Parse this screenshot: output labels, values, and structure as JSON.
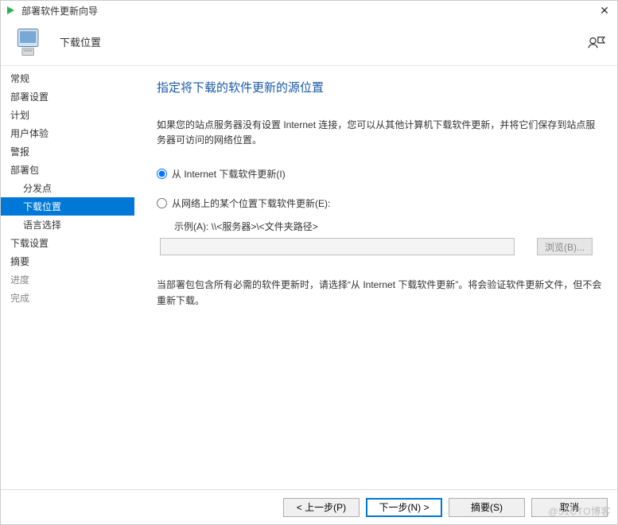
{
  "titlebar": {
    "title": "部署软件更新向导",
    "close_glyph": "✕"
  },
  "header": {
    "title": "下载位置"
  },
  "sidebar": {
    "items": [
      {
        "label": "常规",
        "key": "general"
      },
      {
        "label": "部署设置",
        "key": "deploy-settings"
      },
      {
        "label": "计划",
        "key": "schedule"
      },
      {
        "label": "用户体验",
        "key": "ux"
      },
      {
        "label": "警报",
        "key": "alerts"
      },
      {
        "label": "部署包",
        "key": "package"
      },
      {
        "label": "分发点",
        "key": "distpoints",
        "sub": true
      },
      {
        "label": "下载位置",
        "key": "download-loc",
        "sub": true,
        "selected": true
      },
      {
        "label": "语言选择",
        "key": "languages",
        "sub": true
      },
      {
        "label": "下载设置",
        "key": "download-settings"
      },
      {
        "label": "摘要",
        "key": "summary"
      },
      {
        "label": "进度",
        "key": "progress",
        "disabled": true
      },
      {
        "label": "完成",
        "key": "complete",
        "disabled": true
      }
    ]
  },
  "content": {
    "title": "指定将下载的软件更新的源位置",
    "description": "如果您的站点服务器没有设置 Internet 连接，您可以从其他计算机下载软件更新，并将它们保存到站点服务器可访问的网络位置。",
    "radio_internet": "从 Internet 下载软件更新(I)",
    "radio_network": "从网络上的某个位置下载软件更新(E):",
    "example_label": "示例(A): \\\\<服务器>\\<文件夹路径>",
    "path_value": "",
    "browse_label": "浏览(B)...",
    "note": "当部署包包含所有必需的软件更新时，请选择“从 Internet 下载软件更新”。将会验证软件更新文件，但不会重新下载。",
    "selected_radio": "internet"
  },
  "footer": {
    "back": "<  上一步(P)",
    "next": "下一步(N)  >",
    "summary": "摘要(S)",
    "cancel": "取消"
  },
  "watermark": "@51CTO博客"
}
